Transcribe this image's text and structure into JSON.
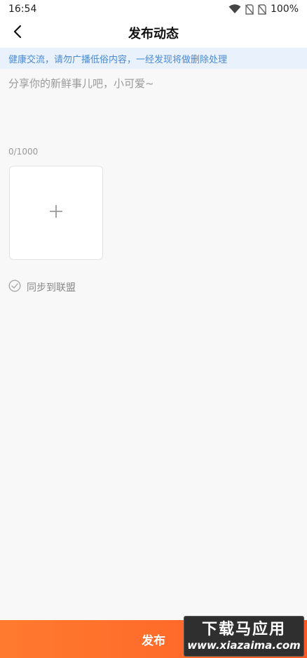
{
  "status_bar": {
    "time": "16:54",
    "battery": "100%",
    "icons": [
      "wifi-icon",
      "no-sim-icon",
      "no-sim-icon"
    ]
  },
  "nav": {
    "title": "发布动态",
    "back_icon": "back-chevron-icon"
  },
  "notice": {
    "text": "健康交流，请勿广播低俗内容，一经发现将做删除处理"
  },
  "editor": {
    "placeholder": "分享你的新鲜事儿吧，小可爱~",
    "value": "",
    "char_count": "0/1000"
  },
  "add_image": {
    "icon": "plus-icon"
  },
  "sync": {
    "label": "同步到联盟",
    "icon": "check-circle-icon",
    "checked": false
  },
  "publish": {
    "label": "发布"
  },
  "watermark": {
    "title": "下载马应用",
    "url": "www.xiazaima.com"
  },
  "colors": {
    "accent": "#ff6a2a",
    "notice_bg": "#e8f1fc",
    "notice_text": "#4a8ad6",
    "background": "#f8f8f8"
  }
}
